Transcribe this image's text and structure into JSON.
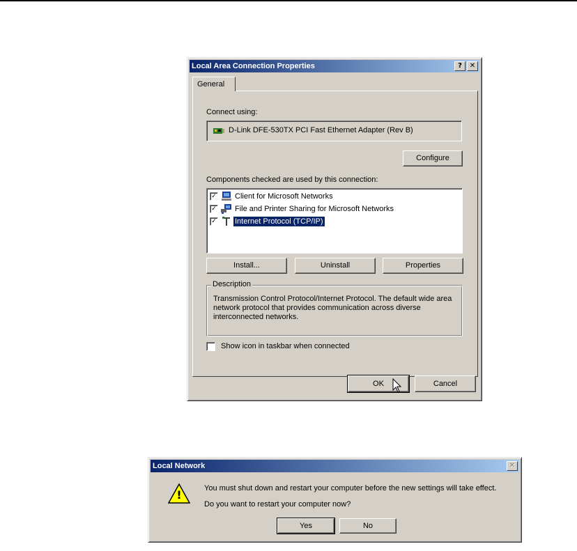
{
  "props_dialog": {
    "title": "Local Area Connection Properties",
    "help_btn": "?",
    "close_btn": "✕",
    "tab_general": "General",
    "connect_using_label": "Connect using:",
    "adapter_name": "D-Link DFE-530TX PCI Fast Ethernet Adapter (Rev B)",
    "configure_btn": "Configure",
    "components_label": "Components checked are used by this connection:",
    "components": [
      {
        "label": "Client for Microsoft Networks",
        "checked": true,
        "icon": "client-icon"
      },
      {
        "label": "File and Printer Sharing for Microsoft Networks",
        "checked": true,
        "icon": "sharing-icon"
      },
      {
        "label": "Internet Protocol (TCP/IP)",
        "checked": true,
        "icon": "protocol-icon",
        "selected": true
      }
    ],
    "check_mark": "✓",
    "install_btn": "Install...",
    "uninstall_btn": "Uninstall",
    "properties_btn": "Properties",
    "description_label": "Description",
    "description_text": "Transmission Control Protocol/Internet Protocol. The default wide area network protocol that provides communication across diverse interconnected networks.",
    "show_icon_label": "Show icon in taskbar when connected",
    "show_icon_checked": false,
    "ok_btn": "OK",
    "cancel_btn": "Cancel"
  },
  "restart_dialog": {
    "title": "Local Network",
    "close_btn": "✕",
    "message": "You must shut down and restart your computer before the new settings will take effect.",
    "question": "Do you want to restart your computer now?",
    "yes_btn": "Yes",
    "no_btn": "No",
    "warning_glyph": "!"
  },
  "colors": {
    "face": "#d4d0c8",
    "title_start": "#0a246a",
    "title_end": "#a6caf0",
    "selection": "#0a246a"
  }
}
